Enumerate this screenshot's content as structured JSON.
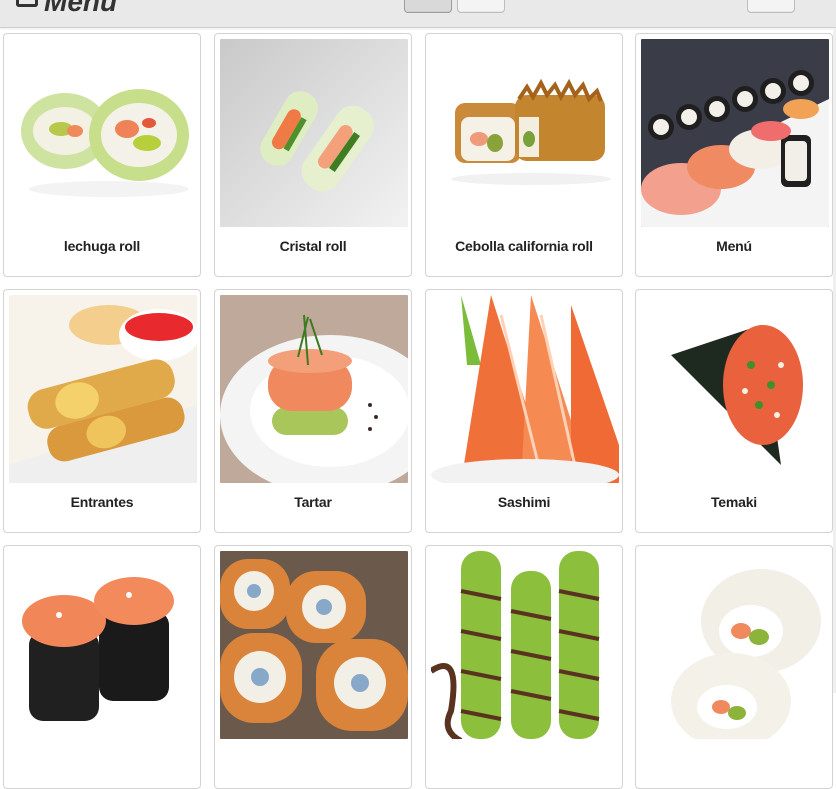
{
  "header": {
    "title": "Menú",
    "brand_icon": "tablet-icon"
  },
  "colors": {
    "toolbar_bg": "#e9e9e9",
    "card_border": "#d3d3d3",
    "label_text": "#222222"
  },
  "items": [
    {
      "label": "lechuga roll",
      "image": "lettuce-roll-image"
    },
    {
      "label": "Cristal roll",
      "image": "crystal-roll-image"
    },
    {
      "label": "Cebolla california roll",
      "image": "onion-california-roll-image"
    },
    {
      "label": "Menú",
      "image": "sushi-platter-image"
    },
    {
      "label": "Entrantes",
      "image": "spring-rolls-image"
    },
    {
      "label": "Tartar",
      "image": "salmon-tartar-image"
    },
    {
      "label": "Sashimi",
      "image": "salmon-sashimi-image"
    },
    {
      "label": "Temaki",
      "image": "temaki-cone-image"
    },
    {
      "label": "",
      "image": "gunkan-salmon-image"
    },
    {
      "label": "",
      "image": "fried-rolls-image"
    },
    {
      "label": "",
      "image": "avocado-eel-rolls-image"
    },
    {
      "label": "",
      "image": "california-roll-image"
    }
  ]
}
